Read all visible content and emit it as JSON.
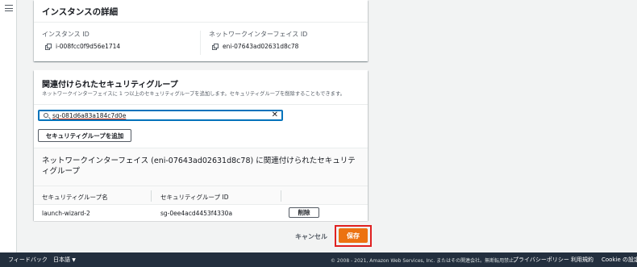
{
  "details_card": {
    "title": "インスタンスの詳細",
    "instance_id_label": "インスタンス ID",
    "instance_id_value": "i-008fcc0f9d56e1714",
    "eni_label": "ネットワークインターフェイス ID",
    "eni_value": "eni-07643ad02631d8c78"
  },
  "sg_card": {
    "title": "関連付けられたセキュリティグループ",
    "description": "ネットワークインターフェイスに 1 つ以上のセキュリティグループを追加します。セキュリティグループを削除することもできます。",
    "search_value": "sg-081d6a83a184c7d0e",
    "add_button": "セキュリティグループを追加",
    "associated_title": "ネットワークインターフェイス (eni-07643ad02631d8c78) に関連付けられたセキュリティグループ",
    "table": {
      "headers": [
        "セキュリティグループ名",
        "セキュリティグループ ID"
      ],
      "rows": [
        {
          "name": "launch-wizard-2",
          "id": "sg-0ee4acd4453f4330a",
          "action": "削除"
        }
      ]
    }
  },
  "actions": {
    "cancel": "キャンセル",
    "save": "保存"
  },
  "footer": {
    "feedback": "フィードバック",
    "language": "日本語",
    "copyright": "© 2008 - 2021, Amazon Web Services, Inc. またはその関連会社。無断転用禁止。",
    "privacy": "プライバシーポリシー",
    "terms": "利用規約",
    "cookie": "Cookie の設定"
  },
  "colors": {
    "primary": "#ec7211",
    "highlight": "#e02020",
    "footer_bg": "#232f3e",
    "focus": "#0073bb"
  },
  "icons": [
    "menu-icon",
    "copy-icon",
    "search-icon",
    "clear-icon",
    "caret-down-icon"
  ]
}
